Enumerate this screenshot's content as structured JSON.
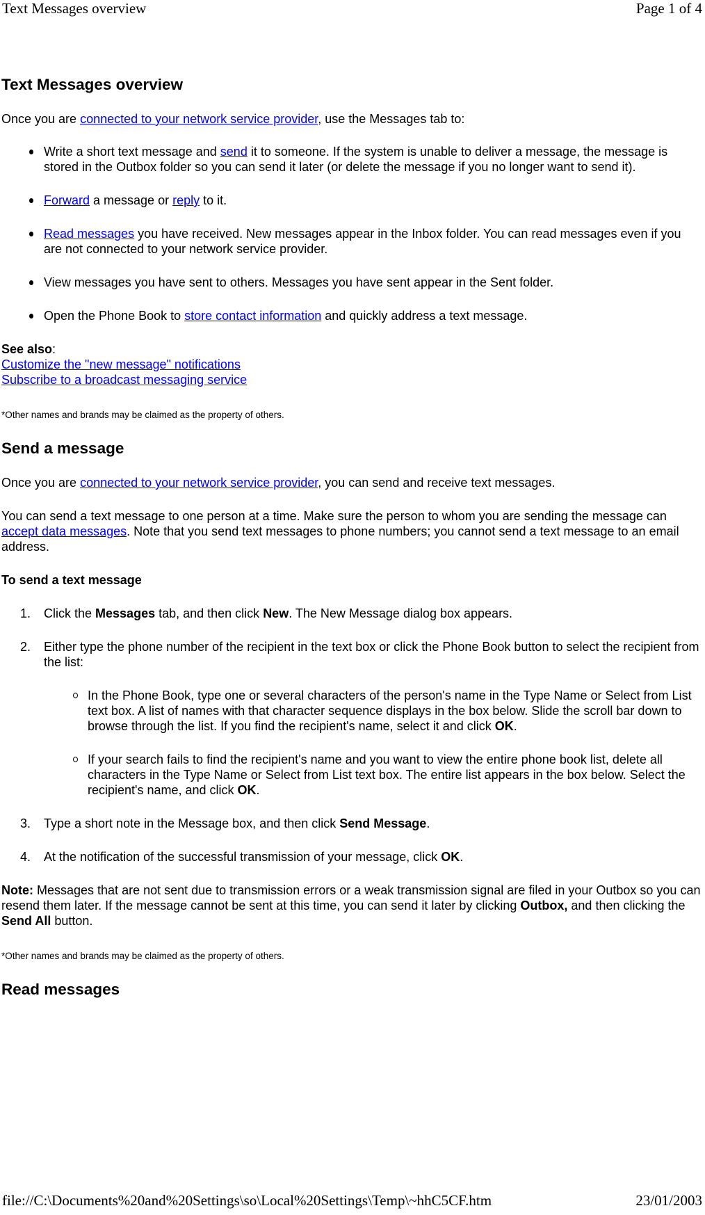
{
  "page_header": {
    "title": "Text Messages overview",
    "page_indicator": "Page 1 of 4"
  },
  "page_footer": {
    "file_path": "file://C:\\Documents%20and%20Settings\\so\\Local%20Settings\\Temp\\~hhC5CF.htm",
    "date": "23/01/2003"
  },
  "colors": {
    "link": "#0000ff",
    "text": "#000000"
  },
  "overview": {
    "heading": "Text Messages overview",
    "intro": {
      "before": "Once you are ",
      "link": "connected to your network service provider",
      "after": ", use the Messages tab to:"
    },
    "bullets": [
      {
        "before": "Write a short text message and ",
        "link": "send",
        "after": " it to someone. If the system is unable to deliver a message, the message is stored in the Outbox folder so you can send it later (or delete the message if you no longer want to send it)."
      },
      {
        "link1": "Forward",
        "middle": " a message or ",
        "link2": "reply",
        "after": " to it."
      },
      {
        "link": "Read messages",
        "after": " you have received. New messages appear in the Inbox folder. You can read messages even if you are not connected to your network service provider."
      },
      {
        "text": "View messages you have sent to others. Messages you have sent appear in the Sent folder."
      },
      {
        "before": "Open the Phone Book to ",
        "link": "store contact information",
        "after": " and quickly address a text message."
      }
    ],
    "see_also_label": "See also",
    "see_also_colon": ":",
    "see_also_links": [
      "Customize the \"new message\" notifications",
      "Subscribe to a broadcast messaging service"
    ],
    "trademark": "*Other names and brands may be claimed as the property of others."
  },
  "send_message": {
    "heading": "Send a message",
    "intro": {
      "before": "Once you are ",
      "link": "connected to your network service provider",
      "after": ", you can send and receive text messages."
    },
    "para2": {
      "before": "You can send a text message to one person at a time. Make sure the person to whom you are sending the message can ",
      "link": "accept data messages",
      "after": ". Note that you send text messages to phone numbers; you cannot send a text message to an email address."
    },
    "procedure_heading": "To send a text message",
    "steps": [
      {
        "number": "1.",
        "t1": "Click the ",
        "b1": "Messages",
        "t2": " tab, and then click ",
        "b2": "New",
        "t3": ". The New Message dialog box appears."
      },
      {
        "number": "2.",
        "text": "Either type the phone number of the recipient in the text box or click the Phone Book button to select the recipient from the list:",
        "substeps": [
          {
            "text": "In the Phone Book, type one or several characters of the person's name in the Type Name or Select from List text box. A list of names with that character sequence displays in the box below. Slide the scroll bar down to browse through the list. If you find the recipient's name, select it and click ",
            "bold": "OK",
            "after": "."
          },
          {
            "text": "If your search fails to find the recipient's name and you want to view the entire phone book list, delete all characters in the Type Name or Select from List text box. The entire list appears in the box below. Select the recipient's name, and click ",
            "bold": "OK",
            "after": "."
          }
        ]
      },
      {
        "number": "3.",
        "text": "Type a short note in the Message box, and then click ",
        "bold": "Send Message",
        "after": "."
      },
      {
        "number": "4.",
        "text": "At the notification of the successful transmission of your message, click ",
        "bold": "OK",
        "after": "."
      }
    ],
    "note": {
      "label": "Note:",
      "t1": " Messages that are not sent due to transmission errors or a weak transmission signal are filed in your Outbox so you can resend them later. If the message cannot be sent at this time, you can send it later by clicking ",
      "b1": "Outbox,",
      "t2": " and then clicking the ",
      "b2": "Send All",
      "t3": " button."
    },
    "trademark": "*Other names and brands may be claimed as the property of others."
  },
  "read_messages": {
    "heading": "Read messages"
  }
}
